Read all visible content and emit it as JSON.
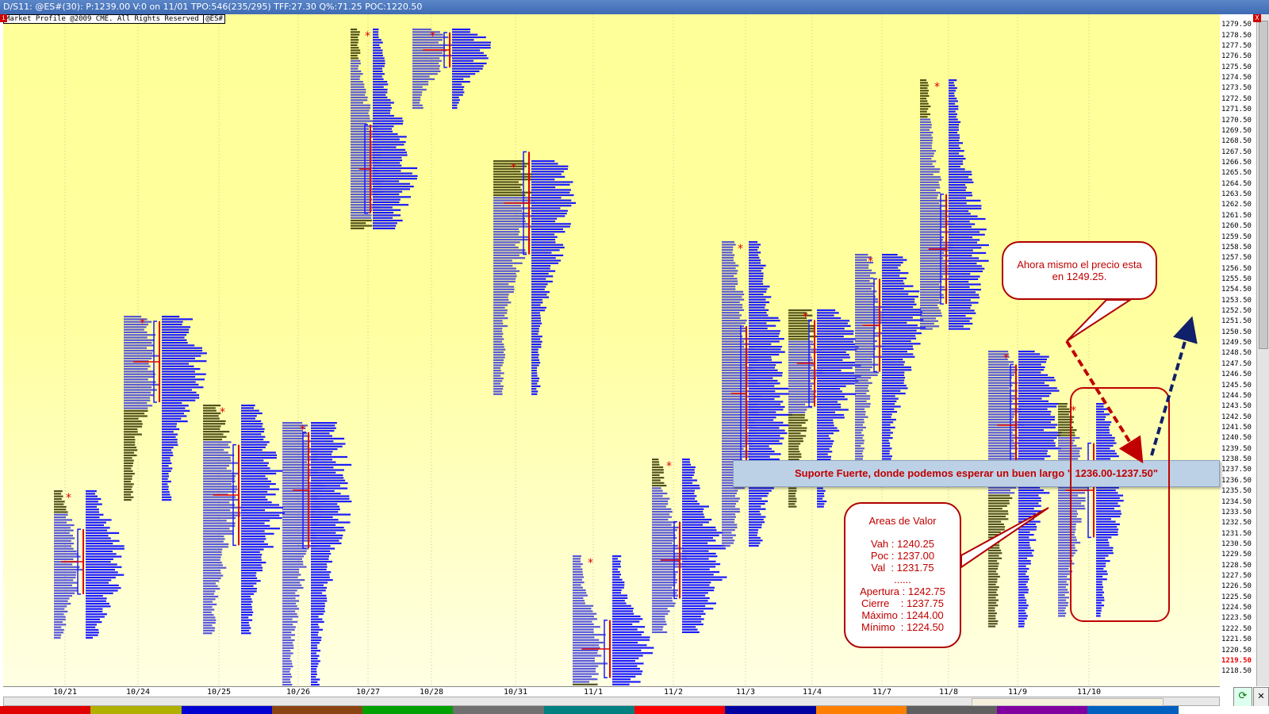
{
  "window": {
    "title": "D/S11: @ES#(30): P:1239.00 V:0 on 11/01 TPO:546(235/295) TFF:27.30 Q%:71.25 POC:1220.50",
    "pin_label": "i",
    "close_label": "X"
  },
  "chart": {
    "copyright": "Market Profile @2009 CME. All Rights Reserved",
    "symbol_tag": "@ES#",
    "current_price": "1219.50",
    "price_ticks": [
      "1279.50",
      "1278.50",
      "1277.50",
      "1276.50",
      "1275.50",
      "1274.50",
      "1273.50",
      "1272.50",
      "1271.50",
      "1270.50",
      "1269.50",
      "1268.50",
      "1267.50",
      "1266.50",
      "1265.50",
      "1264.50",
      "1263.50",
      "1262.50",
      "1261.50",
      "1260.50",
      "1259.50",
      "1258.50",
      "1257.50",
      "1256.50",
      "1255.50",
      "1254.50",
      "1253.50",
      "1252.50",
      "1251.50",
      "1250.50",
      "1249.50",
      "1248.50",
      "1247.50",
      "1246.50",
      "1245.50",
      "1244.50",
      "1243.50",
      "1242.50",
      "1241.50",
      "1240.50",
      "1239.50",
      "1238.50",
      "1237.50",
      "1236.50",
      "1235.50",
      "1234.50",
      "1233.50",
      "1232.50",
      "1231.50",
      "1230.50",
      "1229.50",
      "1228.50",
      "1227.50",
      "1226.50",
      "1225.50",
      "1224.50",
      "1223.50",
      "1222.50",
      "1221.50",
      "1220.50",
      "1219.50",
      "1218.50"
    ],
    "dates": [
      "10/21",
      "10/24",
      "10/25",
      "10/26",
      "10/27",
      "10/28",
      "10/31",
      "11/1",
      "11/2",
      "11/3",
      "11/4",
      "11/7",
      "11/8",
      "11/9",
      "11/10"
    ],
    "colors": {
      "tpo_blue": "#1a1aff",
      "tpo_dark": "#333300",
      "accent_red": "#e00000",
      "arrow_navy": "#10206a",
      "arrow_red": "#c00000"
    },
    "session_colors": [
      "#e00000",
      "#b0b000",
      "#0000d0",
      "#8b4513",
      "#00a000",
      "#707070",
      "#008080",
      "#ff0000",
      "#0000a0",
      "#ff8000",
      "#606060",
      "#8000a0",
      "#0060c0",
      "#ffffff"
    ]
  },
  "annotations": {
    "support": "Suporte Fuerte, donde podemos esperar un buen largo \" 1236.00-1237.50\"",
    "price_now_line1": "Ahora mismo el precio esta",
    "price_now_line2": "en 1249.25.",
    "value_areas": {
      "title": "Areas de Valor",
      "vah": "Vah : 1240.25",
      "poc": "Poc : 1237.00",
      "val": "Val  : 1231.75",
      "sep": "......",
      "apertura": "Apertura : 1242.75",
      "cierre": "Cierre    : 1237.75",
      "maximo": "Máximo : 1244.00",
      "minimo": "Mínimo  : 1224.50"
    }
  },
  "controls": {
    "refresh_icon": "⟳",
    "close_icon": "✕"
  }
}
